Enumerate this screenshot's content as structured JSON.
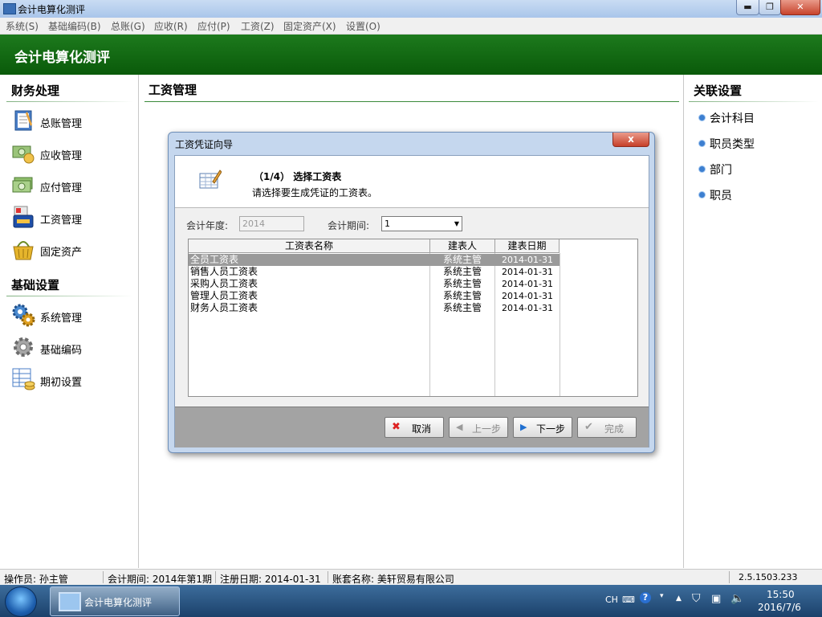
{
  "window": {
    "title": "会计电算化测评",
    "min_glyph": "▬",
    "max_glyph": "❐",
    "close_glyph": "✕"
  },
  "menu": [
    "系统(S)",
    "基础编码(B)",
    "总账(G)",
    "应收(R)",
    "应付(P)",
    "工资(Z)",
    "固定资产(X)",
    "设置(O)"
  ],
  "header": {
    "title": "会计电算化测评"
  },
  "left": {
    "finance_title": "财务处理",
    "finance_items": [
      {
        "label": "总账管理",
        "icon": "ledger-book-icon"
      },
      {
        "label": "应收管理",
        "icon": "money-receive-icon"
      },
      {
        "label": "应付管理",
        "icon": "money-pay-icon"
      },
      {
        "label": "工资管理",
        "icon": "salary-card-icon"
      },
      {
        "label": "固定资产",
        "icon": "shopping-basket-icon"
      }
    ],
    "basic_title": "基础设置",
    "basic_items": [
      {
        "label": "系统管理",
        "icon": "gears-icon"
      },
      {
        "label": "基础编码",
        "icon": "gear-icon"
      },
      {
        "label": "期初设置",
        "icon": "spreadsheet-coins-icon"
      }
    ]
  },
  "main": {
    "title": "工资管理"
  },
  "right": {
    "title": "关联设置",
    "links": [
      "会计科目",
      "职员类型",
      "部门",
      "职员"
    ]
  },
  "dialog": {
    "title": "工资凭证向导",
    "close_glyph": "x",
    "step_title": "（1/4） 选择工资表",
    "step_desc": "请选择要生成凭证的工资表。",
    "year_label": "会计年度:",
    "year_value": "2014",
    "period_label": "会计期间:",
    "period_value": "1",
    "table": {
      "columns": [
        "工资表名称",
        "建表人",
        "建表日期"
      ],
      "rows": [
        {
          "name": "全员工资表",
          "creator": "系统主管",
          "date": "2014-01-31",
          "selected": true
        },
        {
          "name": "销售人员工资表",
          "creator": "系统主管",
          "date": "2014-01-31"
        },
        {
          "name": "采购人员工资表",
          "creator": "系统主管",
          "date": "2014-01-31"
        },
        {
          "name": "管理人员工资表",
          "creator": "系统主管",
          "date": "2014-01-31"
        },
        {
          "name": "财务人员工资表",
          "creator": "系统主管",
          "date": "2014-01-31"
        }
      ]
    },
    "buttons": {
      "cancel": {
        "label": "取消",
        "glyph": "✖"
      },
      "prev": {
        "label": "上一步",
        "glyph": "◀"
      },
      "next": {
        "label": "下一步",
        "glyph": "▶"
      },
      "finish": {
        "label": "完成",
        "glyph": "✔"
      }
    }
  },
  "status": {
    "operator": "操作员: 孙主管",
    "period": "会计期间: 2014年第1期",
    "reg_date": "注册日期: 2014-01-31",
    "account": "账套名称: 美轩贸易有限公司",
    "version": "2.5.1503.233"
  },
  "taskbar": {
    "app_label": "会计电算化测评",
    "lang": "CH",
    "time": "15:50",
    "date": "2016/7/6"
  },
  "colors": {
    "header_green": "#0a5a0a",
    "accent_blue": "#3d7fd0",
    "selection_gray": "#9a9a9a"
  }
}
